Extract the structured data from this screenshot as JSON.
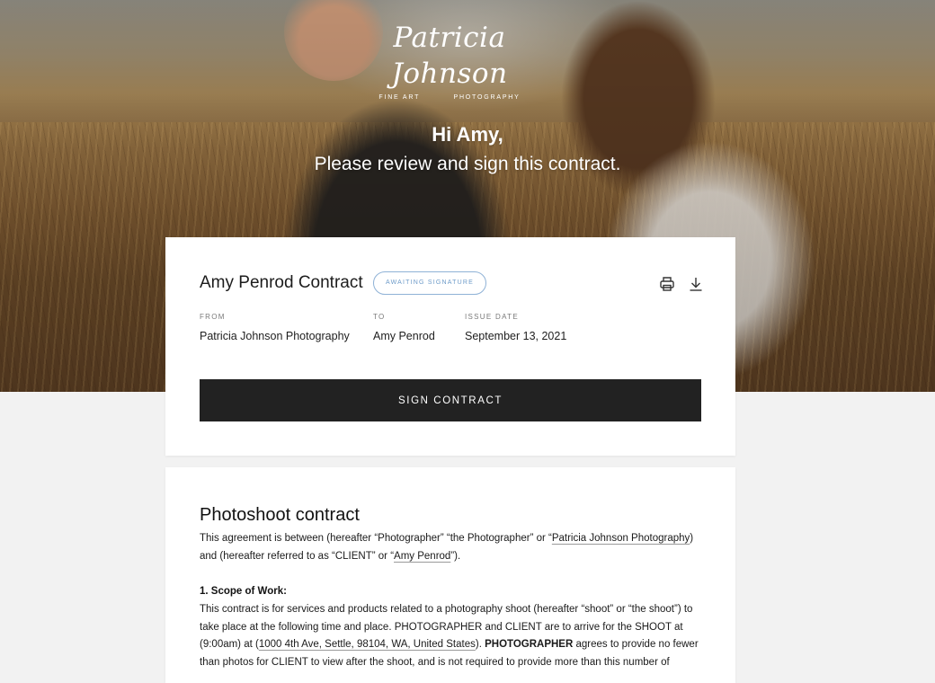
{
  "brand": {
    "logo_script": "Patricia Johnson",
    "logo_sub_left": "FINE ART",
    "logo_sub_right": "PHOTOGRAPHY"
  },
  "hero": {
    "greeting": "Hi Amy,",
    "message": "Please review and sign this contract."
  },
  "summary": {
    "title": "Amy Penrod Contract",
    "status": "AWAITING SIGNATURE",
    "from_label": "FROM",
    "from_value": "Patricia Johnson Photography",
    "to_label": "TO",
    "to_value": "Amy Penrod",
    "date_label": "ISSUE DATE",
    "date_value": "September 13, 2021",
    "sign_label": "SIGN CONTRACT",
    "icons": [
      "print-icon",
      "download-icon"
    ]
  },
  "document": {
    "title": "Photoshoot contract",
    "intro_1": "This agreement is between (hereafter “Photographer” “the Photographer” or “",
    "intro_photographer": "Patricia Johnson Photography",
    "intro_2": ") and (hereafter referred to as “CLIENT” or “",
    "intro_client": "Amy Penrod",
    "intro_3": "”).",
    "scope_heading": "1. Scope of Work:",
    "scope_1": "This contract is for services and products related to a photography shoot (hereafter “shoot” or “the shoot”) to take place at the following time and place. PHOTOGRAPHER and CLIENT are to arrive for the SHOOT at (9:00am) at (",
    "scope_address": "1000 4th Ave, Settle, 98104, WA, United States",
    "scope_2": "). ",
    "scope_bold": "PHOTOGRAPHER",
    "scope_3": " agrees to provide no fewer than photos for CLIENT to view after the shoot, and is not required to provide more than this number of"
  }
}
